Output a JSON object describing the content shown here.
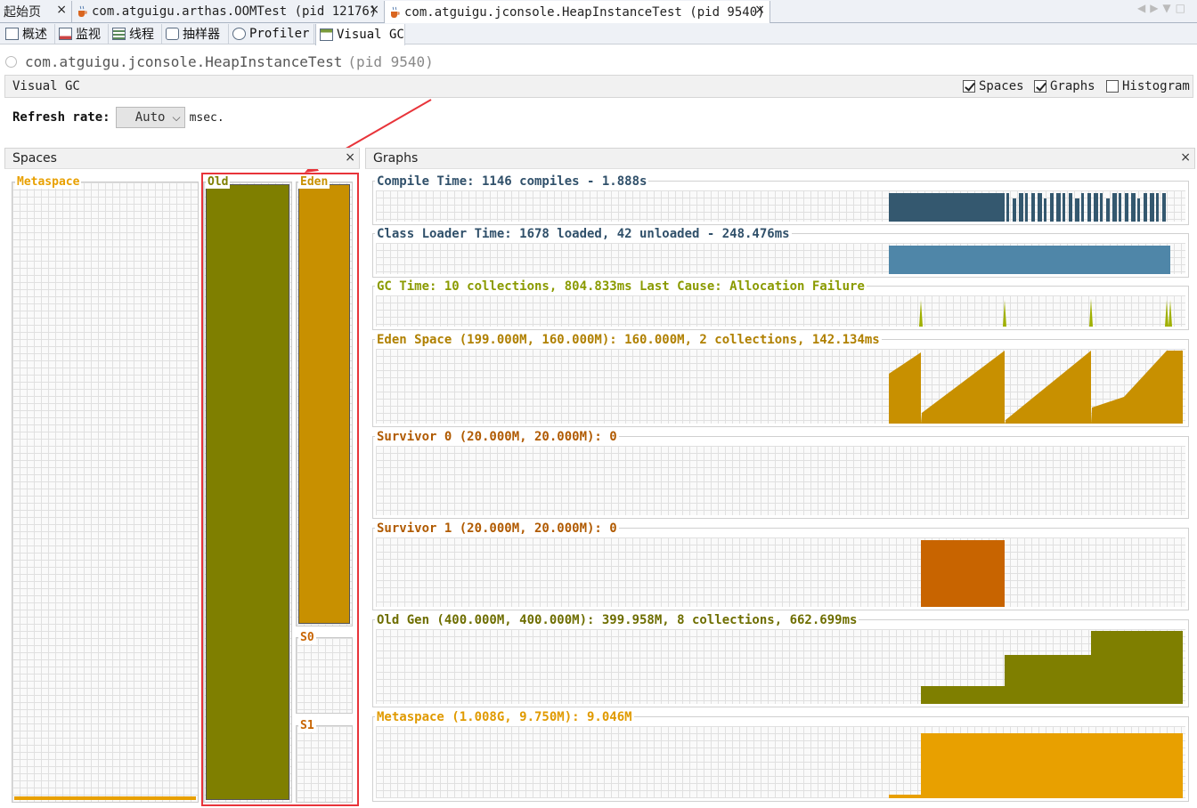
{
  "doc_tabs": [
    {
      "label": "起始页",
      "close": "×"
    },
    {
      "label": "com.atguigu.arthas.OOMTest (pid 12176)",
      "close": "×"
    },
    {
      "label": "com.atguigu.jconsole.HeapInstanceTest (pid 9540)",
      "close": "×",
      "active": true
    }
  ],
  "sub_tabs": [
    {
      "label": "概述"
    },
    {
      "label": "监视"
    },
    {
      "label": "线程"
    },
    {
      "label": "抽样器"
    },
    {
      "label": "Profiler"
    },
    {
      "label": "Visual GC",
      "active": true
    }
  ],
  "header": {
    "app_name": "com.atguigu.jconsole.HeapInstanceTest",
    "pid": "(pid 9540)"
  },
  "visual_gc": {
    "title": "Visual GC",
    "checkboxes": [
      {
        "label": "Spaces",
        "checked": true
      },
      {
        "label": "Graphs",
        "checked": true
      },
      {
        "label": "Histogram",
        "checked": false
      }
    ],
    "refresh_label": "Refresh rate:",
    "refresh_value": "Auto",
    "refresh_unit": "msec."
  },
  "spaces_panel": {
    "title": "Spaces",
    "close": "×",
    "spaces": [
      {
        "name": "Metaspace",
        "color": "#e8a000",
        "fill": 0.006
      },
      {
        "name": "Old",
        "color": "#7f7f00",
        "fill": 1.0
      },
      {
        "name": "Eden",
        "color": "#c89000",
        "fill": 1.0
      },
      {
        "name": "S0",
        "color": "#c86400",
        "fill": 0.0
      },
      {
        "name": "S1",
        "color": "#c86400",
        "fill": 0.0
      }
    ]
  },
  "graphs_panel": {
    "title": "Graphs",
    "close": "×",
    "graphs": [
      {
        "key": "compile",
        "label": "Compile Time: 1146 compiles - 1.888s",
        "label_color": "#30506a",
        "color": "#34586f"
      },
      {
        "key": "classloader",
        "label": "Class Loader Time: 1678 loaded, 42 unloaded - 248.476ms",
        "label_color": "#30506a",
        "color": "#4f86a8"
      },
      {
        "key": "gc",
        "label": "GC Time: 10 collections, 804.833ms Last Cause: Allocation Failure",
        "label_color": "#8a9a00",
        "color": "#a0b000"
      },
      {
        "key": "eden",
        "label": "Eden Space (199.000M, 160.000M): 160.000M, 2 collections, 142.134ms",
        "label_color": "#b08000",
        "color": "#c89000"
      },
      {
        "key": "s0",
        "label": "Survivor 0 (20.000M, 20.000M): 0",
        "label_color": "#b05a00",
        "color": "#c86400"
      },
      {
        "key": "s1",
        "label": "Survivor 1 (20.000M, 20.000M): 0",
        "label_color": "#b05a00",
        "color": "#c86400"
      },
      {
        "key": "old",
        "label": "Old Gen (400.000M, 400.000M): 399.958M, 8 collections, 662.699ms",
        "label_color": "#6e6e00",
        "color": "#7f7f00"
      },
      {
        "key": "meta",
        "label": "Metaspace (1.008G, 9.750M): 9.046M",
        "label_color": "#e09a00",
        "color": "#e8a000"
      }
    ]
  }
}
